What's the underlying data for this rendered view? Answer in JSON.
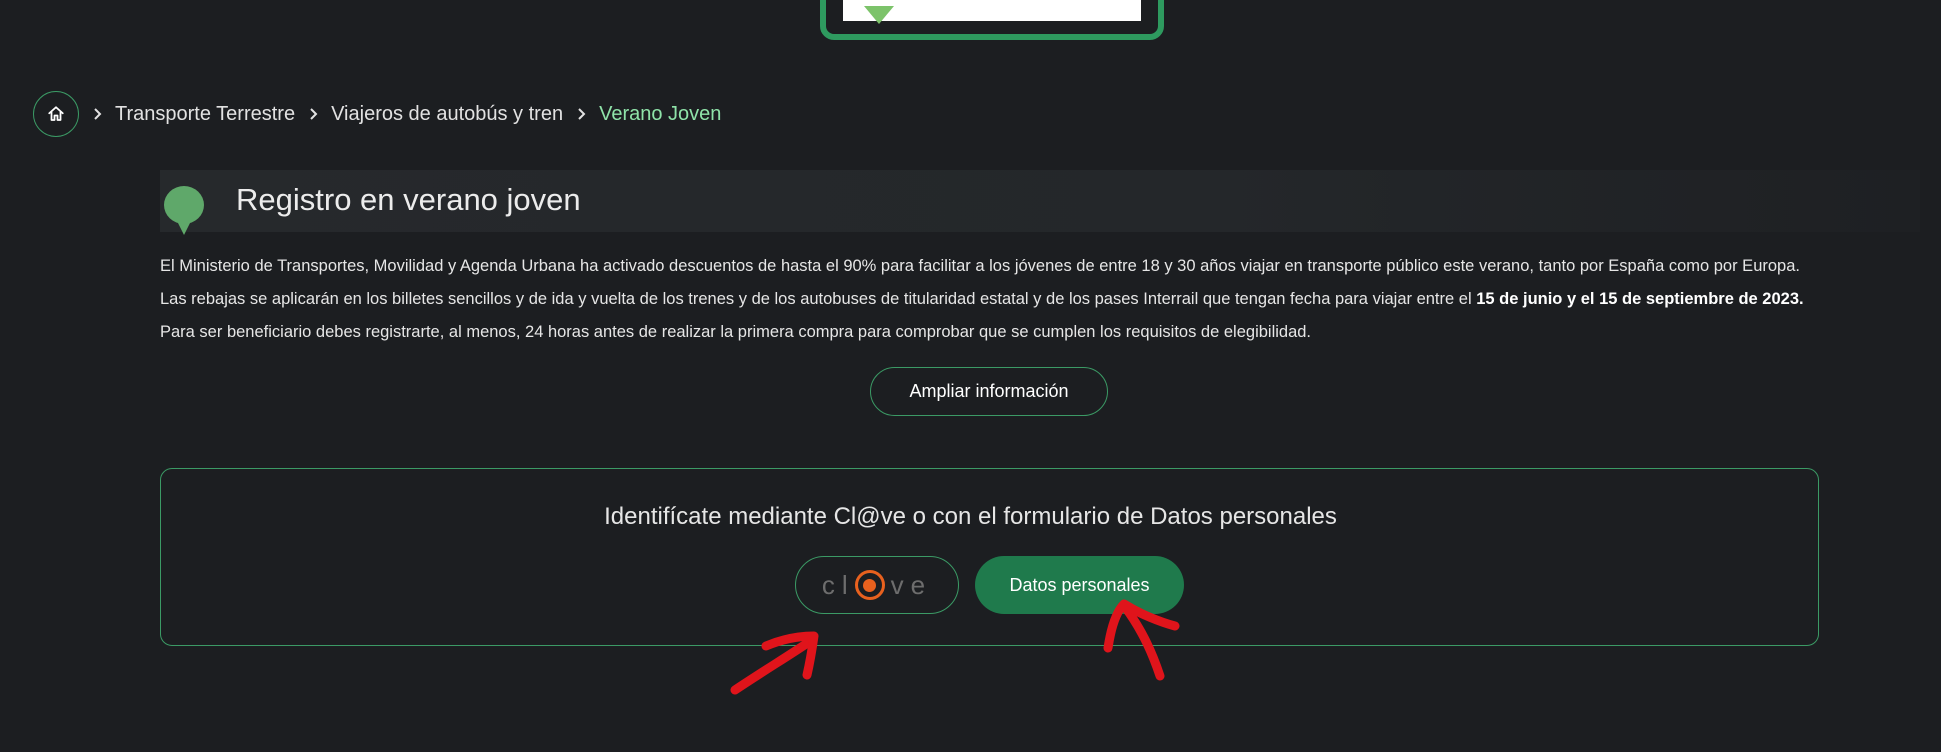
{
  "breadcrumb": {
    "home_icon": "home-icon",
    "items": [
      {
        "label": "Transporte Terrestre"
      },
      {
        "label": "Viajeros de autobús y tren"
      },
      {
        "label": "Verano Joven"
      }
    ]
  },
  "section": {
    "title": "Registro en verano joven",
    "paragraph_1": "El Ministerio de Transportes, Movilidad y Agenda Urbana ha activado descuentos de hasta el 90% para facilitar a los jóvenes de entre 18 y 30 años viajar en transporte público este verano, tanto por España como por Europa.",
    "paragraph_2_prefix": "Las rebajas se aplicarán en los billetes sencillos y de ida y vuelta de los trenes y de los autobuses de titularidad estatal y de los pases Interrail que tengan fecha para viajar entre el ",
    "paragraph_2_bold": "15 de junio y el 15 de septiembre de 2023.",
    "paragraph_3": "Para ser beneficiario debes registrarte, al menos, 24 horas antes de realizar la primera compra para comprobar que se cumplen los requisitos de elegibilidad.",
    "more_button": "Ampliar información"
  },
  "identification": {
    "title": "Identifícate mediante Cl@ve o con el formulario de Datos personales",
    "clave_logo_left": "cl",
    "clave_logo_right": "ve",
    "datos_button": "Datos personales"
  },
  "colors": {
    "background": "#1c1e21",
    "accent_green": "#3b9a65",
    "button_green": "#1f7a4c",
    "active_crumb": "#8fe3a9",
    "clave_orange": "#e8611e",
    "annotation_red": "#e0141b"
  }
}
